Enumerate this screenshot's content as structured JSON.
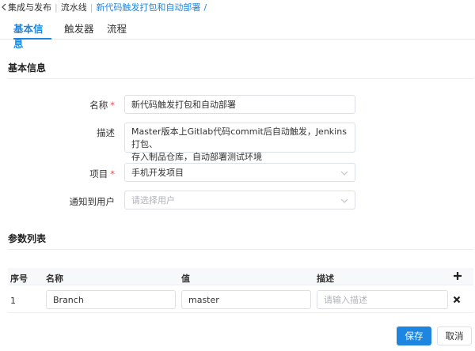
{
  "breadcrumb": {
    "items": [
      "集成与发布",
      "流水线",
      "新代码触发打包和自动部署"
    ],
    "separator": "|",
    "trailing": "/"
  },
  "tabs": [
    {
      "label": "基本信息",
      "active": true
    },
    {
      "label": "触发器",
      "active": false
    },
    {
      "label": "流程",
      "active": false
    }
  ],
  "basic_info": {
    "title": "基本信息",
    "name": {
      "label": "名称",
      "required": "*",
      "value": "新代码触发打包和自动部署"
    },
    "description": {
      "label": "描述",
      "value": "Master版本上Gitlab代码commit后自动触发，Jenkins打包、\n存入制品仓库，自动部署测试环境"
    },
    "project": {
      "label": "项目",
      "required": "*",
      "value": "手机开发项目",
      "icon": "chevron-down-icon"
    },
    "notify": {
      "label": "通知到用户",
      "placeholder": "请选择用户",
      "icon": "chevron-down-icon"
    }
  },
  "params": {
    "title": "参数列表",
    "columns": [
      "序号",
      "名称",
      "值",
      "描述"
    ],
    "add_icon": "plus-icon",
    "rows": [
      {
        "no": "1",
        "name": "Branch",
        "value": "master",
        "desc_placeholder": "请输入描述",
        "delete_icon": "close-icon"
      }
    ]
  },
  "actions": {
    "save": "保存",
    "cancel": "取消"
  },
  "colors": {
    "accent": "#1f86e0",
    "required": "#e5484d",
    "border": "#dcdfe6"
  }
}
